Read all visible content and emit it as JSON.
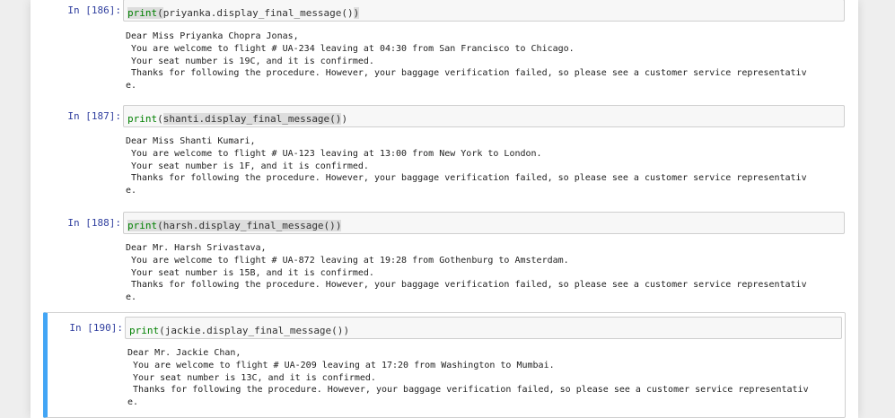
{
  "cells": [
    {
      "prompt": "In [186]:",
      "code": {
        "fn": "print",
        "open": "(",
        "expr": "priyanka.display_final_message()",
        "close": ")"
      },
      "output": [
        "Dear Miss Priyanka Chopra Jonas,",
        " You are welcome to flight # UA-234 leaving at 04:30 from San Francisco to Chicago.",
        " Your seat number is 19C, and it is confirmed.",
        " Thanks for following the procedure. However, your baggage verification failed, so please see a customer service representativ",
        "e."
      ]
    },
    {
      "prompt": "In [187]:",
      "code": {
        "fn": "print",
        "open": "(",
        "expr": "shanti.display_final_message()",
        "close": ")"
      },
      "output": [
        "Dear Miss Shanti Kumari,",
        " You are welcome to flight # UA-123 leaving at 13:00 from New York to London.",
        " Your seat number is 1F, and it is confirmed.",
        " Thanks for following the procedure. However, your baggage verification failed, so please see a customer service representativ",
        "e."
      ]
    },
    {
      "prompt": "In [188]:",
      "code": {
        "fn": "print",
        "open": "(",
        "expr": "harsh.display_final_message()",
        "close": ")"
      },
      "output": [
        "Dear Mr. Harsh Srivastava,",
        " You are welcome to flight # UA-872 leaving at 19:28 from Gothenburg to Amsterdam.",
        " Your seat number is 15B, and it is confirmed.",
        " Thanks for following the procedure. However, your baggage verification failed, so please see a customer service representativ",
        "e."
      ]
    },
    {
      "prompt": "In [190]:",
      "code": {
        "fn": "print",
        "open": "(",
        "expr": "jackie.display_final_message()",
        "close": ")"
      },
      "output": [
        "Dear Mr. Jackie Chan,",
        " You are welcome to flight # UA-209 leaving at 17:20 from Washington to Mumbai.",
        " Your seat number is 13C, and it is confirmed.",
        " Thanks for following the procedure. However, your baggage verification failed, so please see a customer service representativ",
        "e."
      ]
    }
  ],
  "colors": {
    "prompt": "#303f9f",
    "keyword": "#008000",
    "selected_border": "#42a5f5",
    "input_background": "#f7f7f7"
  }
}
